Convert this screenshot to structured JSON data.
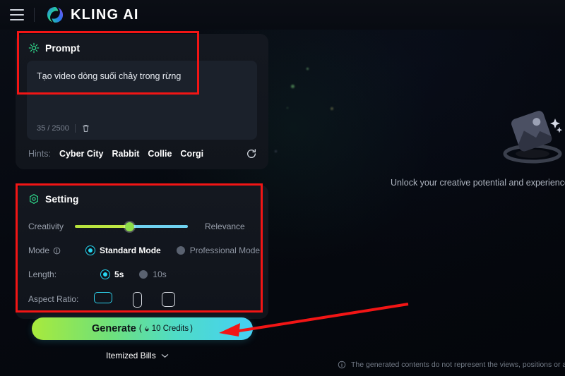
{
  "header": {
    "menu_icon": "hamburger-menu-icon",
    "logo_icon": "kling-logo-icon",
    "brand": "KLING AI"
  },
  "prompt": {
    "icon": "sun-sparkle-icon",
    "title": "Prompt",
    "value": "Tạo video dòng suối chảy trong rừng",
    "placeholder": "Tạo video dòng suối chảy trong rừng",
    "char_count": "35 / 2500",
    "clear_icon": "trash-icon",
    "hints_label": "Hints:",
    "hints": [
      "Cyber City",
      "Rabbit",
      "Collie",
      "Corgi"
    ],
    "refresh_icon": "refresh-icon"
  },
  "setting": {
    "icon": "hex-gear-icon",
    "title": "Setting",
    "slider": {
      "left_label": "Creativity",
      "right_label": "Relevance",
      "value_percent": 48,
      "left_color": "#c2ea46",
      "right_color": "#6fd2f0",
      "thumb_color": "#8ede4a"
    },
    "mode": {
      "label": "Mode",
      "info_icon": "info-circle-icon",
      "options": [
        {
          "label": "Standard Mode",
          "selected": true
        },
        {
          "label": "Professional Mode",
          "selected": false
        }
      ]
    },
    "length": {
      "label": "Length:",
      "options": [
        {
          "label": "5s",
          "selected": true
        },
        {
          "label": "10s",
          "selected": false
        }
      ]
    },
    "aspect_ratio": {
      "label": "Aspect Ratio:",
      "options": [
        {
          "name": "aspect-16-9",
          "selected": true
        },
        {
          "name": "aspect-9-16",
          "selected": false
        },
        {
          "name": "aspect-1-1",
          "selected": false
        }
      ]
    }
  },
  "generate": {
    "label": "Generate",
    "credits": "10 Credits",
    "credits_prefix": "(",
    "credits_suffix": ")",
    "flame_icon": "flame-icon",
    "accent_start": "#a8ea3c",
    "accent_end": "#45d0f5"
  },
  "bills": {
    "label": "Itemized Bills",
    "chevron_icon": "chevron-down-icon"
  },
  "empty_state": {
    "art_icon": "image-placeholder-icon",
    "text": "Unlock your creative potential and experience the"
  },
  "disclaimer": {
    "info_icon": "info-circle-icon",
    "text": "The generated contents do not represent the views, positions or attitudes"
  },
  "annotations": {
    "color": "#f21515",
    "boxes": [
      {
        "name": "prompt-highlight-box"
      },
      {
        "name": "setting-highlight-box"
      }
    ],
    "arrow": {
      "name": "generate-pointer-arrow"
    }
  }
}
